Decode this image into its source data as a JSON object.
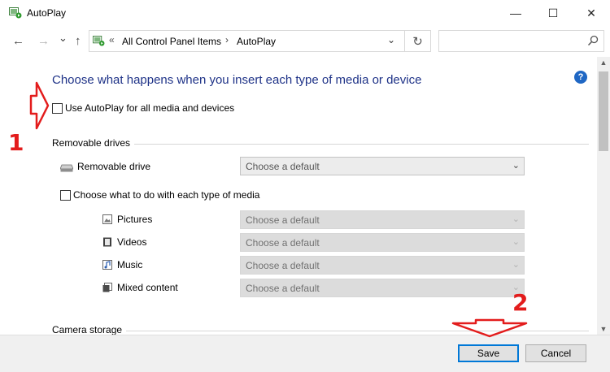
{
  "window": {
    "title": "AutoPlay"
  },
  "titlebar_buttons": {
    "minimize": "—",
    "maximize": "☐",
    "close": "✕"
  },
  "nav": {
    "back": "←",
    "forward": "→",
    "recent": "⌄",
    "up": "↑"
  },
  "addressbar": {
    "overflow": "«",
    "crumbs": [
      "All Control Panel Items",
      "AutoPlay"
    ],
    "separator": "›",
    "dropdown": "⌄",
    "refresh": "↻"
  },
  "search": {
    "placeholder": ""
  },
  "page": {
    "heading": "Choose what happens when you insert each type of media or device",
    "help": "?",
    "use_autoplay_label": "Use AutoPlay for all media and devices"
  },
  "removable": {
    "section_label": "Removable drives",
    "drive_label": "Removable drive",
    "drive_value": "Choose a default",
    "choose_each_label": "Choose what to do with each type of media",
    "media": [
      {
        "label": "Pictures",
        "value": "Choose a default",
        "icon": "pictures-icon"
      },
      {
        "label": "Videos",
        "value": "Choose a default",
        "icon": "videos-icon"
      },
      {
        "label": "Music",
        "value": "Choose a default",
        "icon": "music-icon"
      },
      {
        "label": "Mixed content",
        "value": "Choose a default",
        "icon": "mixed-content-icon"
      }
    ]
  },
  "camera": {
    "section_label": "Camera storage"
  },
  "footer": {
    "save": "Save",
    "cancel": "Cancel"
  },
  "annotations": {
    "one": "1",
    "two": "2"
  },
  "dropdown_arrow": "⌄",
  "colors": {
    "heading": "#1e3287",
    "annotation": "#e31c1c",
    "help": "#1f67c4",
    "accent": "#0078d7"
  }
}
